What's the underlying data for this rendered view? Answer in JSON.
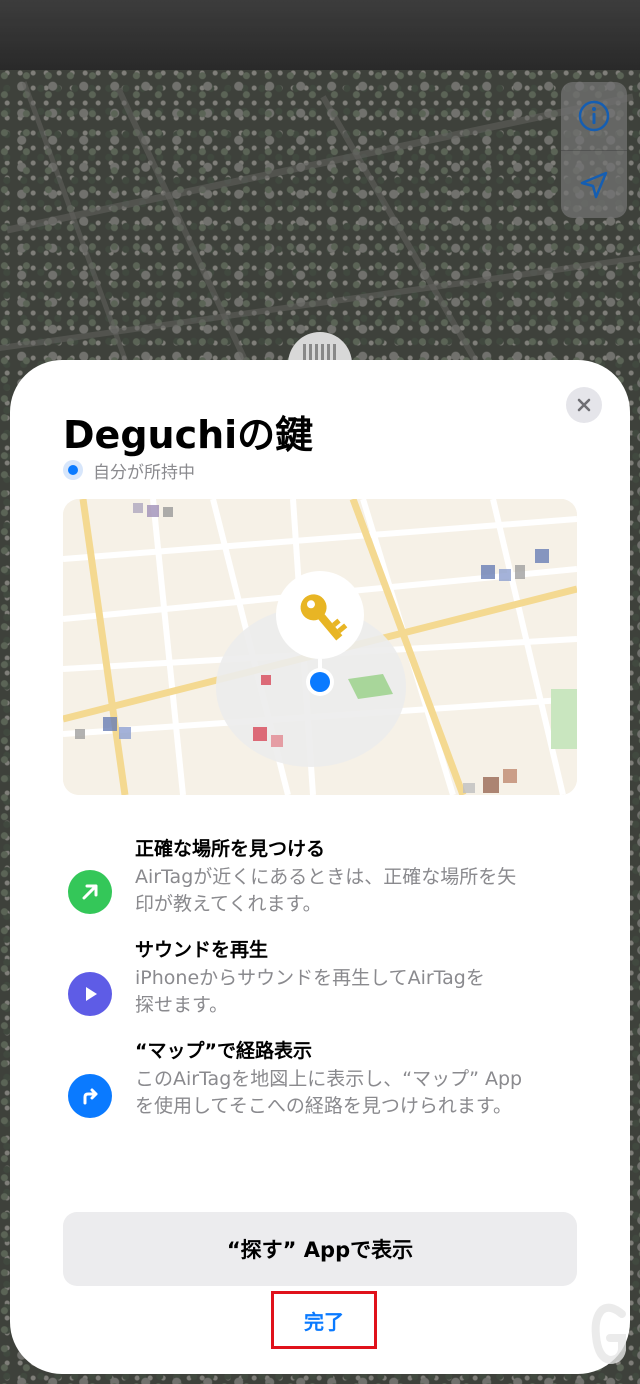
{
  "sheet": {
    "title": "Deguchiの鍵",
    "status": "自分が所持中",
    "close_icon": "close-icon"
  },
  "map_controls": {
    "info_icon": "info-icon",
    "location_icon": "location-arrow-icon"
  },
  "mini_map": {
    "marker_icon": "key-icon"
  },
  "features": [
    {
      "icon": "arrow-up-right-icon",
      "color": "#34c759",
      "title": "正確な場所を見つける",
      "desc_line1": "AirTagが近くにあるときは、正確な場所を矢",
      "desc_line2": "印が教えてくれます。"
    },
    {
      "icon": "play-icon",
      "color": "#5e5ce6",
      "title": "サウンドを再生",
      "desc_line1": "iPhoneからサウンドを再生してAirTagを",
      "desc_line2": "探せます。"
    },
    {
      "icon": "directions-arrow-icon",
      "color": "#0a7aff",
      "title": "“マップ”で経路表示",
      "desc_line1": "このAirTagを地図上に表示し、“マップ” App",
      "desc_line2": "を使用してそこへの経路を見つけられます。"
    }
  ],
  "buttons": {
    "show_in_findmy": "“探す” Appで表示",
    "done": "完了"
  },
  "colors": {
    "accent": "#0a7aff",
    "highlight_box": "#e0111b"
  }
}
